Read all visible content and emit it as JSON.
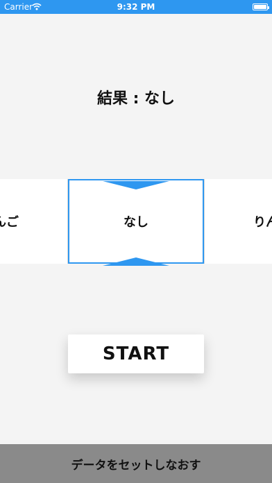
{
  "status_bar": {
    "carrier": "Carrier",
    "time": "9:32 PM",
    "color": "#2e97f0"
  },
  "result": {
    "text": "結果 : なし"
  },
  "carousel": {
    "items": [
      "りんご",
      "なし",
      "りんご"
    ],
    "selected_index": 1,
    "selector_color": "#2e97f0"
  },
  "start_button": {
    "label": "START"
  },
  "reset_button": {
    "label": "データをセットしなおす"
  }
}
